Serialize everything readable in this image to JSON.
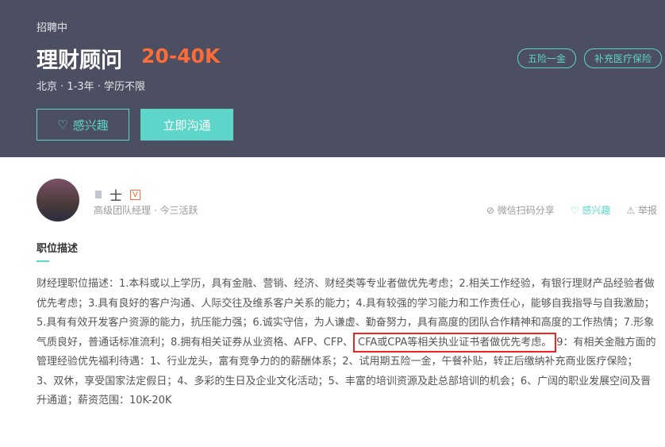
{
  "job": {
    "status": "招聘中",
    "title": "理财顾问",
    "salary": "20-40K",
    "meta": "北京 · 1-3年 · 学历不限",
    "tags": [
      "五险一金",
      "补充医疗保险"
    ],
    "interest_button": "感兴趣",
    "chat_button": "立即沟通"
  },
  "recruiter": {
    "name": "士",
    "role": "高级团队经理",
    "active": "今三活跃",
    "actions": {
      "share": "微信扫码分享",
      "interest": "感兴趣",
      "report": "举报"
    }
  },
  "description": {
    "heading": "职位描述",
    "lines": [
      "财经理职位描述：1.本科或以上学历，具有金融、营销、经济、财经类等专业者做优先考虑；2.相关工作经验，有银行理财产品经验者做",
      "优先考虑；3.具有良好的客户沟通、人际交往及维系客户关系的能力；4.具有较强的学习能力和工作责任心，能够自我指导与自我激励；",
      "5.具有有效开发客户资源的能力，抗压能力强；6.诚实守信，为人谦虚、勤奋努力，具有高度的团队合作精神和高度的工作热情；7.形象",
      "气质良好，普通话标准流利；8.拥有相关证券从业资格、AFP、CFP、",
      "管理经验优先福利待遇：1、行业龙头，富有竞争力的的薪酬体系；2、试用期五险一金，午餐补贴，转正后缴纳补充商业医疗保险；",
      "3、双休，享受国家法定假日；4、多彩的生日及企业文化活动；5、丰富的培训资源及赴总部培训的机会；6、广阔的职业发展空间及晋",
      "升通道；薪资范围：10K-20K"
    ],
    "highlight": "CFA或CPA等相关执业证书者做优先考虑。",
    "line4_tail": "9：有相关金融方面的"
  }
}
